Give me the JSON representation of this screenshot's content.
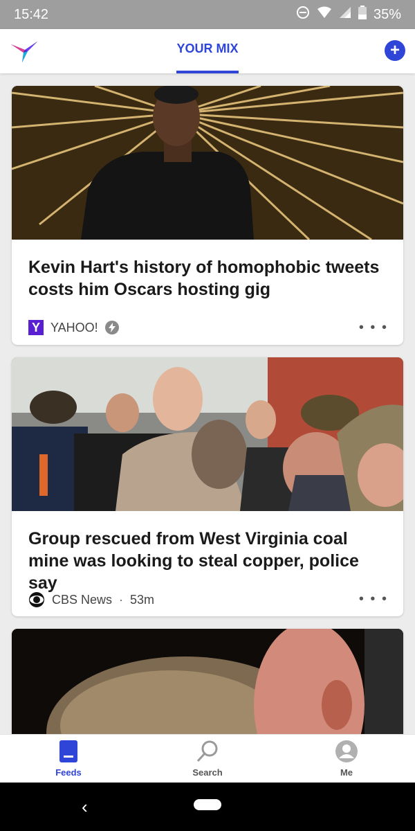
{
  "status_bar": {
    "time": "15:42",
    "battery": "35%"
  },
  "header": {
    "tab_label": "YOUR MIX",
    "accent_color": "#2f45d8"
  },
  "feed": {
    "articles": [
      {
        "title": "Kevin Hart's history of homophobic tweets costs him Oscars hosting gig",
        "source": "YAHOO!",
        "source_icon": "yahoo-logo",
        "time": "",
        "more": "• • •"
      },
      {
        "title": "Group rescued from West Virginia coal mine was looking to steal copper, police say",
        "source": "CBS News",
        "source_icon": "cbs-eye-logo",
        "time": "53m",
        "separator": "·",
        "more": "• • •"
      }
    ]
  },
  "bottom_nav": {
    "items": [
      {
        "label": "Feeds",
        "icon": "feeds-icon",
        "active": true
      },
      {
        "label": "Search",
        "icon": "search-icon",
        "active": false
      },
      {
        "label": "Me",
        "icon": "profile-icon",
        "active": false
      }
    ]
  }
}
